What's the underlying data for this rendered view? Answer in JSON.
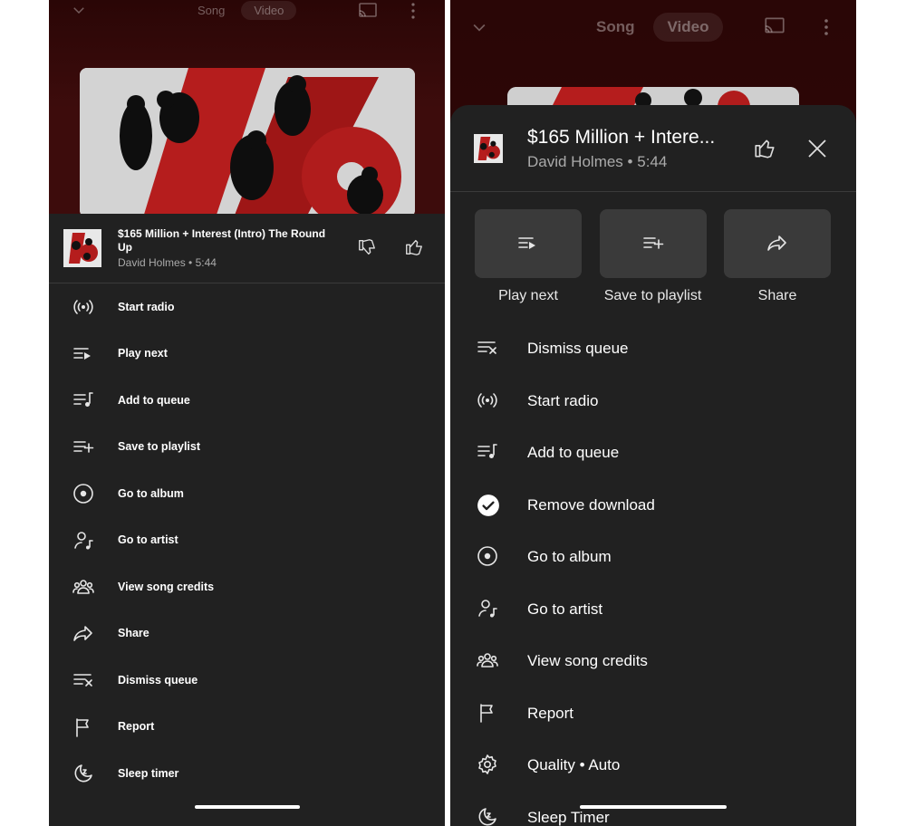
{
  "tabs": {
    "song": "Song",
    "video": "Video"
  },
  "track": {
    "title_left": "$165 Million + Interest (Intro) The Round Up",
    "title_right": "$165 Million + Intere...",
    "artist": "David Holmes",
    "duration": "5:44",
    "sep": "•"
  },
  "left_menu": [
    {
      "label": "Start radio",
      "icon": "radio-icon"
    },
    {
      "label": "Play next",
      "icon": "play-next-icon"
    },
    {
      "label": "Add to queue",
      "icon": "add-to-queue-icon"
    },
    {
      "label": "Save to playlist",
      "icon": "playlist-add-icon"
    },
    {
      "label": "Go to album",
      "icon": "album-icon"
    },
    {
      "label": "Go to artist",
      "icon": "artist-icon"
    },
    {
      "label": "View song credits",
      "icon": "credits-icon"
    },
    {
      "label": "Share",
      "icon": "share-icon"
    },
    {
      "label": "Dismiss queue",
      "icon": "dismiss-queue-icon"
    },
    {
      "label": "Report",
      "icon": "flag-icon"
    },
    {
      "label": "Sleep timer",
      "icon": "sleep-timer-icon"
    }
  ],
  "right_tiles": [
    {
      "label": "Play next",
      "icon": "play-next-icon"
    },
    {
      "label": "Save to playlist",
      "icon": "playlist-add-icon"
    },
    {
      "label": "Share",
      "icon": "share-icon"
    }
  ],
  "right_menu": [
    {
      "label": "Dismiss queue",
      "icon": "dismiss-queue-icon"
    },
    {
      "label": "Start radio",
      "icon": "radio-icon"
    },
    {
      "label": "Add to queue",
      "icon": "add-to-queue-icon"
    },
    {
      "label": "Remove download",
      "icon": "download-check-icon"
    },
    {
      "label": "Go to album",
      "icon": "album-icon"
    },
    {
      "label": "Go to artist",
      "icon": "artist-icon"
    },
    {
      "label": "View song credits",
      "icon": "credits-icon"
    },
    {
      "label": "Report",
      "icon": "flag-icon"
    },
    {
      "label": "Quality • Auto",
      "icon": "gear-icon"
    },
    {
      "label": "Sleep Timer",
      "icon": "sleep-timer-icon"
    }
  ],
  "colors": {
    "sheet": "#212121",
    "backdrop": "#3d0c0c",
    "text": "#ffffff",
    "subtext": "#aaaaaa",
    "art_red": "#b01c1c"
  }
}
